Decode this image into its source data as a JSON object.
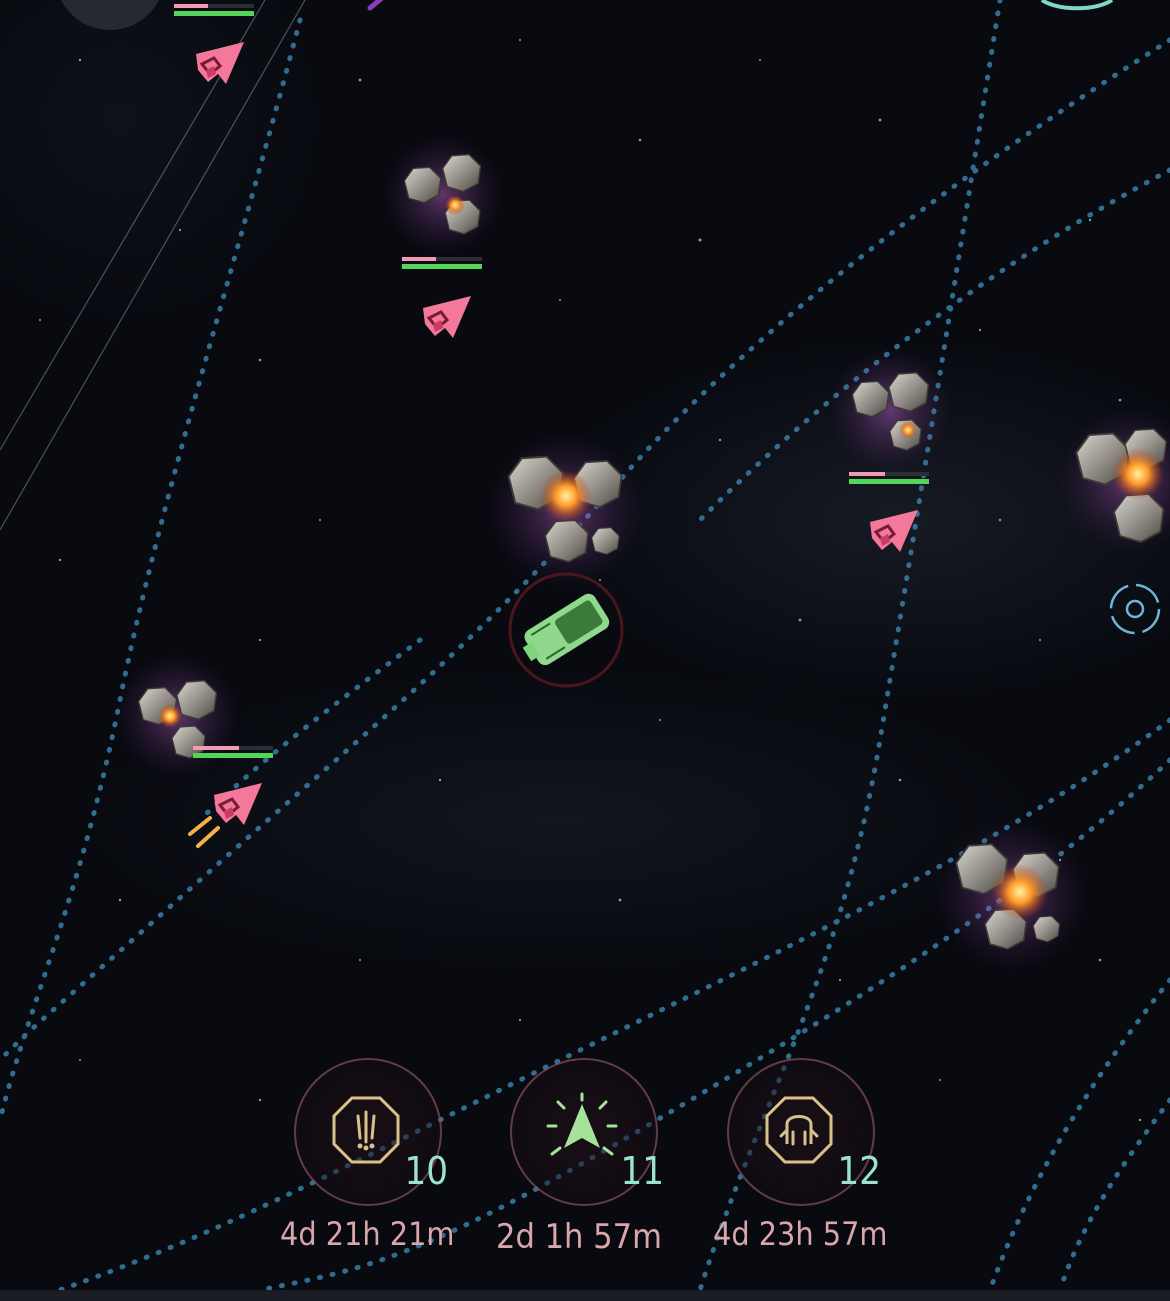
{
  "colors": {
    "enemy": "#f4789a",
    "player": "#8ee08a",
    "orbit": "#3b86b0",
    "hp_green": "#52d65a",
    "hp_pink": "#f39ab2",
    "level_text": "#9be3d0",
    "timer_text": "#d9a6ac"
  },
  "map": {
    "asteroid_clusters": [
      {
        "id": "cluster-1",
        "has_health_bar": true
      },
      {
        "id": "cluster-2",
        "has_health_bar": true
      },
      {
        "id": "cluster-3",
        "has_health_bar": false
      },
      {
        "id": "cluster-4",
        "has_health_bar": true
      },
      {
        "id": "cluster-5",
        "has_health_bar": false
      },
      {
        "id": "cluster-6",
        "has_health_bar": false
      }
    ],
    "enemy_markers": [
      "enemy-ship-icon",
      "enemy-ship-icon",
      "enemy-ship-icon",
      "enemy-ship-icon"
    ],
    "player_ship": "player-ship-icon",
    "target_icon": "locate-target-icon"
  },
  "fleet_bar": {
    "items": [
      {
        "icon": "warning-octagon-icon",
        "level": "10",
        "timer": "4d 21h 21m"
      },
      {
        "icon": "ship-burst-icon",
        "level": "11",
        "timer": "2d 1h 57m"
      },
      {
        "icon": "shield-octagon-icon",
        "level": "12",
        "timer": "4d 23h 57m"
      }
    ]
  }
}
